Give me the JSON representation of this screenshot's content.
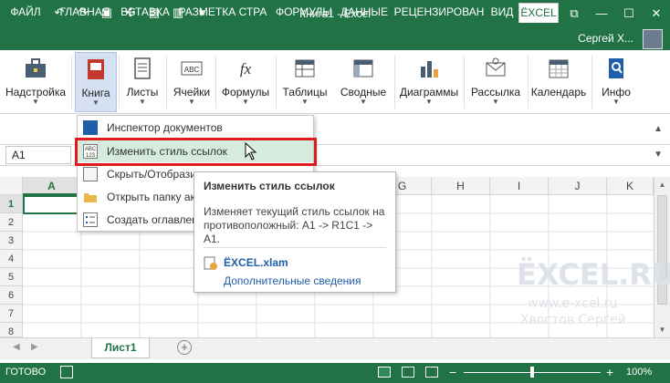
{
  "window": {
    "title": "Книга1 - Excel",
    "user": "Сергей Х..."
  },
  "qat": [
    "xl-icon",
    "save-icon",
    "undo-icon",
    "redo-icon",
    "camera-icon",
    "macro-icon",
    "image-icon",
    "chart-icon",
    "dropdown-icon"
  ],
  "tabs": [
    {
      "label": "ФАЙЛ"
    },
    {
      "label": "ГЛАВНАЯ"
    },
    {
      "label": "ВСТАВКА"
    },
    {
      "label": "РАЗМЕТКА СТРА"
    },
    {
      "label": "ФОРМУЛЫ"
    },
    {
      "label": "ДАННЫЕ"
    },
    {
      "label": "РЕЦЕНЗИРОВАН"
    },
    {
      "label": "ВИД"
    },
    {
      "label": "ЁXCEL"
    }
  ],
  "ribbon": [
    {
      "label": "Надстройка",
      "icon": "toolbox-icon"
    },
    {
      "label": "Книга",
      "icon": "book-icon"
    },
    {
      "label": "Листы",
      "icon": "sheets-icon"
    },
    {
      "label": "Ячейки",
      "icon": "cells-icon"
    },
    {
      "label": "Формулы",
      "icon": "fx-icon"
    },
    {
      "label": "Таблицы",
      "icon": "table-icon"
    },
    {
      "label": "Сводные",
      "icon": "pivot-icon"
    },
    {
      "label": "Диаграммы",
      "icon": "chart-icon"
    },
    {
      "label": "Рассылка",
      "icon": "mail-icon"
    },
    {
      "label": "Календарь",
      "icon": "calendar-icon"
    },
    {
      "label": "Инфо",
      "icon": "info-icon"
    }
  ],
  "namebox": "A1",
  "columns": [
    "A",
    "B",
    "C",
    "D",
    "E",
    "F",
    "G",
    "H",
    "I",
    "J",
    "K"
  ],
  "rows": [
    "1",
    "2",
    "3",
    "4",
    "5",
    "6",
    "7",
    "8"
  ],
  "menu": [
    {
      "label": "Инспектор документов",
      "icon": "inspector-icon"
    },
    {
      "label": "Изменить стиль ссылок",
      "icon": "abc-icon"
    },
    {
      "label": "Скрыть/Отобрази",
      "icon": "hide-icon"
    },
    {
      "label": "Открыть папку ак",
      "icon": "folder-icon"
    },
    {
      "label": "Создать оглавлен",
      "icon": "toc-icon"
    }
  ],
  "tooltip": {
    "title": "Изменить стиль ссылок",
    "body": "Изменяет текущий стиль ссылок на противоположный: A1 -> R1C1 -> A1.",
    "addin": "ЁXCEL.xlam",
    "more": "Дополнительные сведения"
  },
  "sheet": {
    "tab": "Лист1"
  },
  "status": {
    "ready": "ГОТОВО",
    "zoom": "100%"
  },
  "watermark": {
    "logo": "ЁXCEL.RU",
    "url": "www.e-xcel.ru",
    "author": "Хвостов Сергей"
  },
  "colors": {
    "accent": "#217346",
    "highlight": "#e01b1b"
  }
}
